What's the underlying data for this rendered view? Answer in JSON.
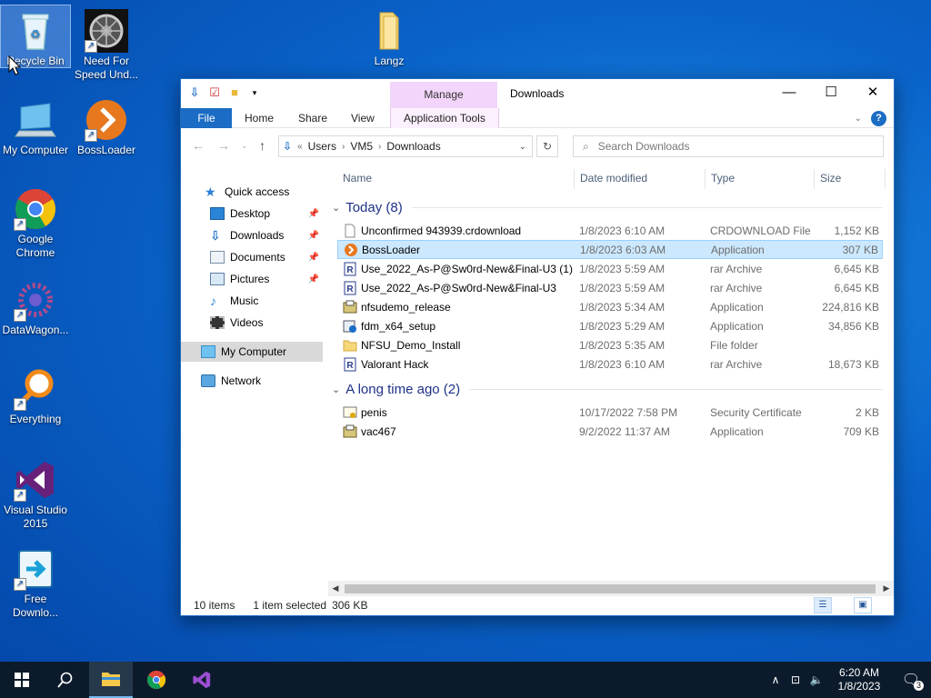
{
  "desktop": {
    "icons": [
      {
        "label": "Recycle Bin"
      },
      {
        "label": "Need For Speed Und..."
      },
      {
        "label": "Langz"
      },
      {
        "label": "My Computer"
      },
      {
        "label": "BossLoader"
      },
      {
        "label": "Google Chrome"
      },
      {
        "label": "DataWagon..."
      },
      {
        "label": "Everything"
      },
      {
        "label": "Visual Studio 2015"
      },
      {
        "label": "Free Downlo..."
      }
    ]
  },
  "window": {
    "title": "Downloads",
    "manage_tab": "Manage",
    "tabs": {
      "file": "File",
      "home": "Home",
      "share": "Share",
      "view": "View",
      "app_tools": "Application Tools"
    },
    "address": {
      "prefix": "«",
      "segments": [
        "Users",
        "VM5",
        "Downloads"
      ]
    },
    "search_placeholder": "Search Downloads",
    "nav": {
      "quick_access": "Quick access",
      "desktop": "Desktop",
      "downloads": "Downloads",
      "documents": "Documents",
      "pictures": "Pictures",
      "music": "Music",
      "videos": "Videos",
      "my_computer": "My Computer",
      "network": "Network"
    },
    "columns": {
      "name": "Name",
      "date": "Date modified",
      "type": "Type",
      "size": "Size"
    },
    "groups": {
      "today": "Today (8)",
      "long_ago": "A long time ago (2)"
    },
    "files_today": [
      {
        "name": "Unconfirmed 943939.crdownload",
        "date": "1/8/2023 6:10 AM",
        "type": "CRDOWNLOAD File",
        "size": "1,152 KB"
      },
      {
        "name": "BossLoader",
        "date": "1/8/2023 6:03 AM",
        "type": "Application",
        "size": "307 KB"
      },
      {
        "name": "Use_2022_As-P@Sw0rd-New&Final-U3 (1)",
        "date": "1/8/2023 5:59 AM",
        "type": "rar Archive",
        "size": "6,645 KB"
      },
      {
        "name": "Use_2022_As-P@Sw0rd-New&Final-U3",
        "date": "1/8/2023 5:59 AM",
        "type": "rar Archive",
        "size": "6,645 KB"
      },
      {
        "name": "nfsudemo_release",
        "date": "1/8/2023 5:34 AM",
        "type": "Application",
        "size": "224,816 KB"
      },
      {
        "name": "fdm_x64_setup",
        "date": "1/8/2023 5:29 AM",
        "type": "Application",
        "size": "34,856 KB"
      },
      {
        "name": "NFSU_Demo_Install",
        "date": "1/8/2023 5:35 AM",
        "type": "File folder",
        "size": ""
      },
      {
        "name": "Valorant Hack",
        "date": "1/8/2023 6:10 AM",
        "type": "rar Archive",
        "size": "18,673 KB"
      }
    ],
    "files_old": [
      {
        "name": "penis",
        "date": "10/17/2022 7:58 PM",
        "type": "Security Certificate",
        "size": "2 KB"
      },
      {
        "name": "vac467",
        "date": "9/2/2022 11:37 AM",
        "type": "Application",
        "size": "709 KB"
      }
    ],
    "status": {
      "items": "10 items",
      "selected": "1 item selected",
      "size": "306 KB"
    }
  },
  "taskbar": {
    "time": "6:20 AM",
    "date": "1/8/2023",
    "notifications": "3"
  },
  "colors": {
    "accent": "#1a6cc4",
    "selection": "#cce8ff",
    "manage_tab": "#f3d5fb",
    "taskbar": "#0c1b2c"
  }
}
